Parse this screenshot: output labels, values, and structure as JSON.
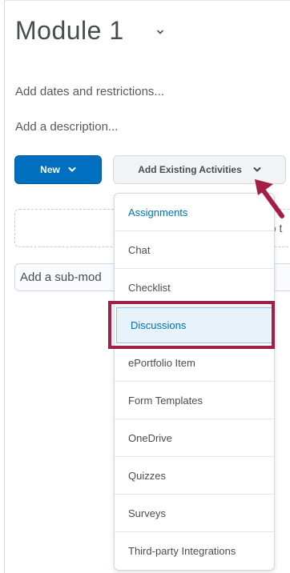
{
  "page": {
    "title": "Module 1",
    "add_dates_link": "Add dates and restrictions...",
    "add_description_link": "Add a description...",
    "drop_zone_text": "op t",
    "sub_module_placeholder": "Add a sub-mod"
  },
  "toolbar": {
    "new_label": "New",
    "add_existing_label": "Add Existing Activities"
  },
  "menu": {
    "items": [
      {
        "label": "Assignments"
      },
      {
        "label": "Chat"
      },
      {
        "label": "Checklist"
      },
      {
        "label": "Discussions",
        "highlighted": true
      },
      {
        "label": "ePortfolio Item"
      },
      {
        "label": "Form Templates"
      },
      {
        "label": "OneDrive"
      },
      {
        "label": "Quizzes"
      },
      {
        "label": "Surveys"
      },
      {
        "label": "Third-party Integrations"
      }
    ]
  },
  "colors": {
    "primary_blue": "#006fbf",
    "annotation_red": "#a41e45",
    "hover_bg": "#e8f2fb"
  },
  "icons": {
    "title_chevron": "chevron-down-icon",
    "new_chevron": "chevron-down-icon",
    "existing_chevron": "chevron-down-icon",
    "annotation_arrow": "arrow-icon"
  }
}
